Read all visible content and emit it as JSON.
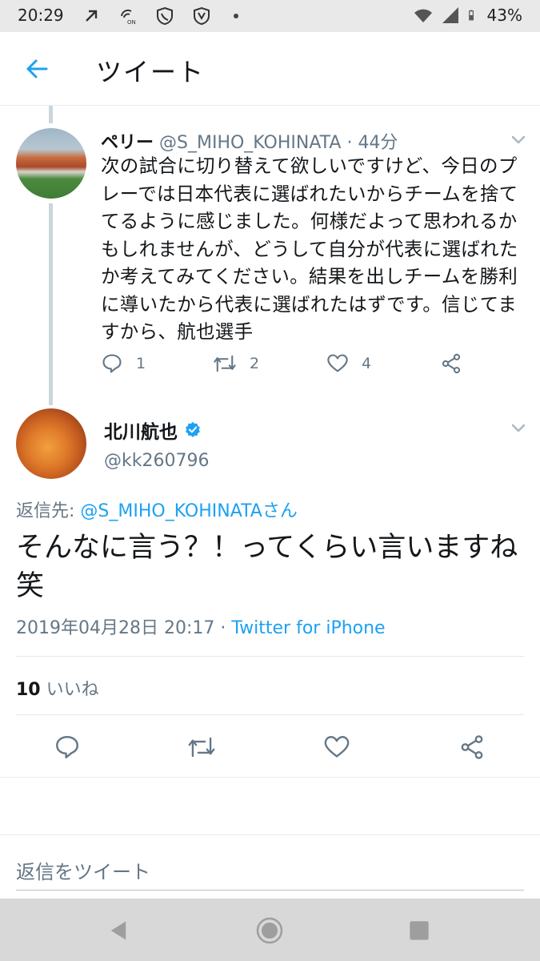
{
  "status_bar": {
    "time": "20:29",
    "battery": "43%",
    "icons_left": [
      "usb-debug-icon",
      "wifi-calling-on-icon",
      "phone-shield-icon",
      "shield-icon"
    ],
    "icons_right": [
      "wifi-icon",
      "cellular-signal-icon",
      "battery-icon"
    ]
  },
  "app_bar": {
    "title": "ツイート"
  },
  "parent_tweet": {
    "name": "ペリー",
    "handle_time": "@S_MIHO_KOHINATA · 44分",
    "text": "次の試合に切り替えて欲しいですけど、今日のプレーでは日本代表に選ばれたいからチームを捨ててるように感じました。何様だよって思われるかもしれませんが、どうして自分が代表に選ばれたか考えてみてください。結果を出しチームを勝利に導いたから代表に選ばれたはずです。信じてますから、航也選手",
    "reply_count": "1",
    "retweet_count": "2",
    "like_count": "4"
  },
  "main_tweet": {
    "name": "北川航也",
    "handle": "@kk260796",
    "reply_label": "返信先: ",
    "reply_to": "@S_MIHO_KOHINATAさん",
    "text": "そんなに言う？！ってくらい言いますね笑",
    "timestamp": "2019年04月28日 20:17 · ",
    "source": "Twitter for iPhone",
    "likes_count": "10",
    "likes_label": " いいね"
  },
  "reply_composer": {
    "placeholder": "返信をツイート"
  },
  "colors": {
    "accent": "#1da1f2",
    "secondary_text": "#657786",
    "primary_text": "#14171a"
  }
}
